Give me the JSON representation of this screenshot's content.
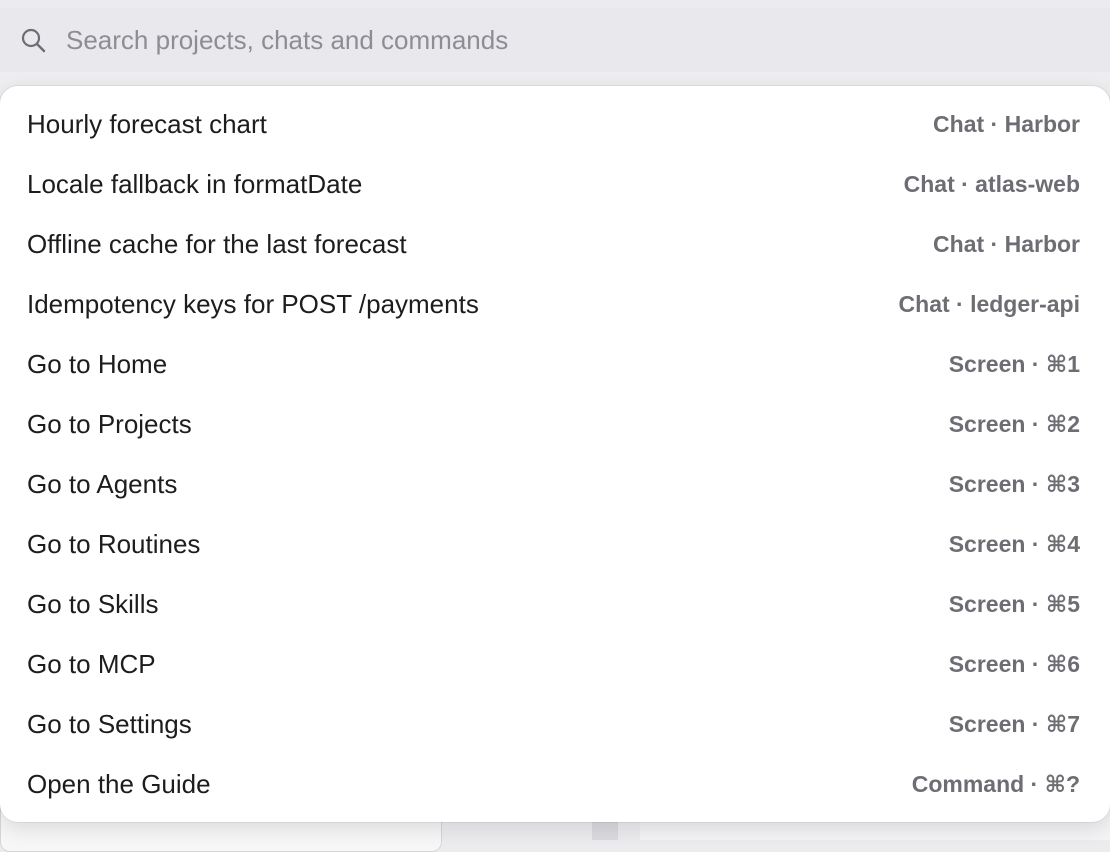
{
  "search": {
    "placeholder": "Search projects, chats and commands",
    "value": ""
  },
  "icons": {
    "search": "magnifying-glass"
  },
  "colors": {
    "caret": "#3478f6",
    "placeholder": "#8e8d93",
    "meta_text": "#6e6d73"
  },
  "results": [
    {
      "title": "Hourly forecast chart",
      "meta": "Chat · Harbor"
    },
    {
      "title": "Locale fallback in formatDate",
      "meta": "Chat · atlas-web"
    },
    {
      "title": "Offline cache for the last forecast",
      "meta": "Chat · Harbor"
    },
    {
      "title": "Idempotency keys for POST /payments",
      "meta": "Chat · ledger-api"
    },
    {
      "title": "Go to Home",
      "meta": "Screen · ⌘1"
    },
    {
      "title": "Go to Projects",
      "meta": "Screen · ⌘2"
    },
    {
      "title": "Go to Agents",
      "meta": "Screen · ⌘3"
    },
    {
      "title": "Go to Routines",
      "meta": "Screen · ⌘4"
    },
    {
      "title": "Go to Skills",
      "meta": "Screen · ⌘5"
    },
    {
      "title": "Go to MCP",
      "meta": "Screen · ⌘6"
    },
    {
      "title": "Go to Settings",
      "meta": "Screen · ⌘7"
    },
    {
      "title": "Open the Guide",
      "meta": "Command · ⌘?"
    }
  ]
}
